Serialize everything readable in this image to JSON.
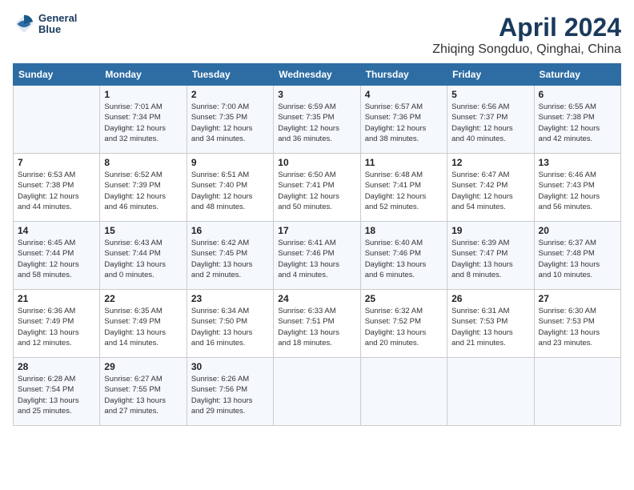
{
  "header": {
    "logo_line1": "General",
    "logo_line2": "Blue",
    "month_year": "April 2024",
    "location": "Zhiqing Songduo, Qinghai, China"
  },
  "weekdays": [
    "Sunday",
    "Monday",
    "Tuesday",
    "Wednesday",
    "Thursday",
    "Friday",
    "Saturday"
  ],
  "weeks": [
    [
      {
        "day": "",
        "info": ""
      },
      {
        "day": "1",
        "info": "Sunrise: 7:01 AM\nSunset: 7:34 PM\nDaylight: 12 hours\nand 32 minutes."
      },
      {
        "day": "2",
        "info": "Sunrise: 7:00 AM\nSunset: 7:35 PM\nDaylight: 12 hours\nand 34 minutes."
      },
      {
        "day": "3",
        "info": "Sunrise: 6:59 AM\nSunset: 7:35 PM\nDaylight: 12 hours\nand 36 minutes."
      },
      {
        "day": "4",
        "info": "Sunrise: 6:57 AM\nSunset: 7:36 PM\nDaylight: 12 hours\nand 38 minutes."
      },
      {
        "day": "5",
        "info": "Sunrise: 6:56 AM\nSunset: 7:37 PM\nDaylight: 12 hours\nand 40 minutes."
      },
      {
        "day": "6",
        "info": "Sunrise: 6:55 AM\nSunset: 7:38 PM\nDaylight: 12 hours\nand 42 minutes."
      }
    ],
    [
      {
        "day": "7",
        "info": "Sunrise: 6:53 AM\nSunset: 7:38 PM\nDaylight: 12 hours\nand 44 minutes."
      },
      {
        "day": "8",
        "info": "Sunrise: 6:52 AM\nSunset: 7:39 PM\nDaylight: 12 hours\nand 46 minutes."
      },
      {
        "day": "9",
        "info": "Sunrise: 6:51 AM\nSunset: 7:40 PM\nDaylight: 12 hours\nand 48 minutes."
      },
      {
        "day": "10",
        "info": "Sunrise: 6:50 AM\nSunset: 7:41 PM\nDaylight: 12 hours\nand 50 minutes."
      },
      {
        "day": "11",
        "info": "Sunrise: 6:48 AM\nSunset: 7:41 PM\nDaylight: 12 hours\nand 52 minutes."
      },
      {
        "day": "12",
        "info": "Sunrise: 6:47 AM\nSunset: 7:42 PM\nDaylight: 12 hours\nand 54 minutes."
      },
      {
        "day": "13",
        "info": "Sunrise: 6:46 AM\nSunset: 7:43 PM\nDaylight: 12 hours\nand 56 minutes."
      }
    ],
    [
      {
        "day": "14",
        "info": "Sunrise: 6:45 AM\nSunset: 7:44 PM\nDaylight: 12 hours\nand 58 minutes."
      },
      {
        "day": "15",
        "info": "Sunrise: 6:43 AM\nSunset: 7:44 PM\nDaylight: 13 hours\nand 0 minutes."
      },
      {
        "day": "16",
        "info": "Sunrise: 6:42 AM\nSunset: 7:45 PM\nDaylight: 13 hours\nand 2 minutes."
      },
      {
        "day": "17",
        "info": "Sunrise: 6:41 AM\nSunset: 7:46 PM\nDaylight: 13 hours\nand 4 minutes."
      },
      {
        "day": "18",
        "info": "Sunrise: 6:40 AM\nSunset: 7:46 PM\nDaylight: 13 hours\nand 6 minutes."
      },
      {
        "day": "19",
        "info": "Sunrise: 6:39 AM\nSunset: 7:47 PM\nDaylight: 13 hours\nand 8 minutes."
      },
      {
        "day": "20",
        "info": "Sunrise: 6:37 AM\nSunset: 7:48 PM\nDaylight: 13 hours\nand 10 minutes."
      }
    ],
    [
      {
        "day": "21",
        "info": "Sunrise: 6:36 AM\nSunset: 7:49 PM\nDaylight: 13 hours\nand 12 minutes."
      },
      {
        "day": "22",
        "info": "Sunrise: 6:35 AM\nSunset: 7:49 PM\nDaylight: 13 hours\nand 14 minutes."
      },
      {
        "day": "23",
        "info": "Sunrise: 6:34 AM\nSunset: 7:50 PM\nDaylight: 13 hours\nand 16 minutes."
      },
      {
        "day": "24",
        "info": "Sunrise: 6:33 AM\nSunset: 7:51 PM\nDaylight: 13 hours\nand 18 minutes."
      },
      {
        "day": "25",
        "info": "Sunrise: 6:32 AM\nSunset: 7:52 PM\nDaylight: 13 hours\nand 20 minutes."
      },
      {
        "day": "26",
        "info": "Sunrise: 6:31 AM\nSunset: 7:53 PM\nDaylight: 13 hours\nand 21 minutes."
      },
      {
        "day": "27",
        "info": "Sunrise: 6:30 AM\nSunset: 7:53 PM\nDaylight: 13 hours\nand 23 minutes."
      }
    ],
    [
      {
        "day": "28",
        "info": "Sunrise: 6:28 AM\nSunset: 7:54 PM\nDaylight: 13 hours\nand 25 minutes."
      },
      {
        "day": "29",
        "info": "Sunrise: 6:27 AM\nSunset: 7:55 PM\nDaylight: 13 hours\nand 27 minutes."
      },
      {
        "day": "30",
        "info": "Sunrise: 6:26 AM\nSunset: 7:56 PM\nDaylight: 13 hours\nand 29 minutes."
      },
      {
        "day": "",
        "info": ""
      },
      {
        "day": "",
        "info": ""
      },
      {
        "day": "",
        "info": ""
      },
      {
        "day": "",
        "info": ""
      }
    ]
  ]
}
